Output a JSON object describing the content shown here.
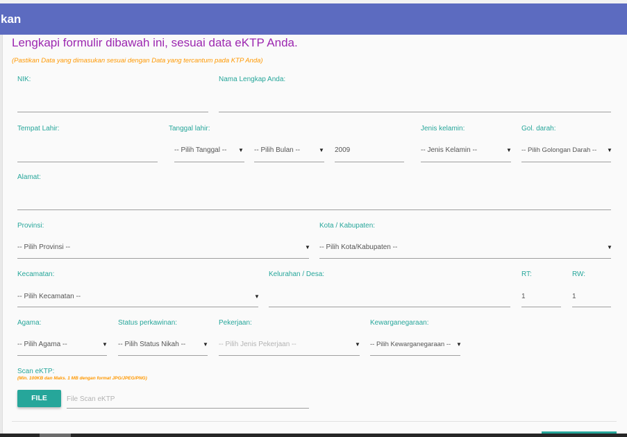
{
  "header": {
    "title": "kan"
  },
  "form": {
    "title": "Lengkapi formulir dibawah ini, sesuai data eKTP Anda.",
    "notice": "(Pastikan Data yang dimasukan sesuai dengan Data yang tercantum pada KTP Anda)",
    "nik": {
      "label": "NIK:",
      "value": ""
    },
    "nama": {
      "label": "Nama Lengkap Anda:",
      "value": ""
    },
    "tempat_lahir": {
      "label": "Tempat Lahir:",
      "value": ""
    },
    "tanggal_lahir": {
      "label": "Tanggal lahir:",
      "day": "-- Pilih Tanggal --",
      "month": "-- Pilih Bulan --",
      "year": "2009"
    },
    "jenis_kelamin": {
      "label": "Jenis kelamin:",
      "value": "-- Jenis Kelamin --"
    },
    "gol_darah": {
      "label": "Gol. darah:",
      "value": "-- Pilih Golongan Darah --"
    },
    "alamat": {
      "label": "Alamat:",
      "value": ""
    },
    "provinsi": {
      "label": "Provinsi:",
      "value": "-- Pilih Provinsi --"
    },
    "kota": {
      "label": "Kota / Kabupaten:",
      "value": "-- Pilih Kota/Kabupaten --"
    },
    "kecamatan": {
      "label": "Kecamatan:",
      "value": "-- Pilih Kecamatan --"
    },
    "kelurahan": {
      "label": "Kelurahan / Desa:",
      "value": ""
    },
    "rt": {
      "label": "RT:",
      "value": "1"
    },
    "rw": {
      "label": "RW:",
      "value": "1"
    },
    "agama": {
      "label": "Agama:",
      "value": "-- Pilih Agama --"
    },
    "status": {
      "label": "Status perkawinan:",
      "value": "-- Pilih Status Nikah --"
    },
    "pekerjaan": {
      "label": "Pekerjaan:",
      "value": "-- Pilih Jenis Pekerjaan --"
    },
    "kewarganegaraan": {
      "label": "Kewarganegaraan:",
      "value": "-- Pilih Kewarganegaraan --"
    },
    "scan": {
      "label": "Scan eKTP:",
      "hint": "(Min. 100KB dan Maks. 1 MB dengan format JPG/JPEG/PNG)",
      "button": "FILE",
      "placeholder": "File Scan eKTP"
    }
  },
  "colors": {
    "header": "#5c6bc0",
    "accent": "#26a69a",
    "title": "#9c27b0",
    "notice": "#ff9800"
  },
  "icons": {
    "dropdown": "caret-down-icon"
  }
}
